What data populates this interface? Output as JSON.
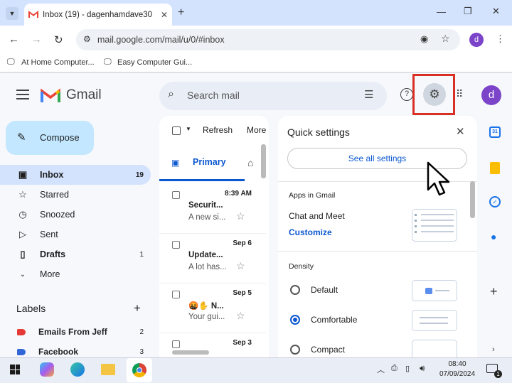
{
  "browser": {
    "tab_title": "Inbox (19) - dagenhamdave30",
    "url": "mail.google.com/mail/u/0/#inbox",
    "profile_initial": "d",
    "bookmarks": [
      "At Home Computer...",
      "Easy Computer Gui..."
    ]
  },
  "gmail": {
    "brand": "Gmail",
    "search_placeholder": "Search mail",
    "account_initial": "d",
    "compose_label": "Compose",
    "nav": [
      {
        "label": "Inbox",
        "count": "19"
      },
      {
        "label": "Starred",
        "count": ""
      },
      {
        "label": "Snoozed",
        "count": ""
      },
      {
        "label": "Sent",
        "count": ""
      },
      {
        "label": "Drafts",
        "count": "1"
      },
      {
        "label": "More",
        "count": ""
      }
    ],
    "labels_heading": "Labels",
    "labels": [
      {
        "label": "Emails From Jeff",
        "count": "2",
        "color": "#e53935"
      },
      {
        "label": "Facebook",
        "count": "3",
        "color": "#3367d6"
      }
    ],
    "toolbar": {
      "refresh": "Refresh",
      "more": "More"
    },
    "tab_primary": "Primary",
    "emails": [
      {
        "date": "8:39 AM",
        "sender": "Securit...",
        "snippet": "A new si..."
      },
      {
        "date": "Sep 6",
        "sender": "Update...",
        "snippet": "A lot has..."
      },
      {
        "date": "Sep 5",
        "sender": "🤬✋ N...",
        "snippet": "Your gui..."
      },
      {
        "date": "Sep 3",
        "sender": "",
        "snippet": ""
      }
    ]
  },
  "quick_settings": {
    "title": "Quick settings",
    "see_all": "See all settings",
    "apps_heading": "Apps in Gmail",
    "chat_meet": "Chat and Meet",
    "customize": "Customize",
    "density_heading": "Density",
    "options": [
      "Default",
      "Comfortable",
      "Compact"
    ],
    "selected": "Comfortable"
  },
  "taskbar": {
    "time": "08:40",
    "date": "07/09/2024",
    "notification_count": "1"
  },
  "colors": {
    "accent": "#0b57d0",
    "highlight": "#d93025",
    "compose_bg": "#c2e7ff",
    "nav_active": "#d3e3fd"
  }
}
